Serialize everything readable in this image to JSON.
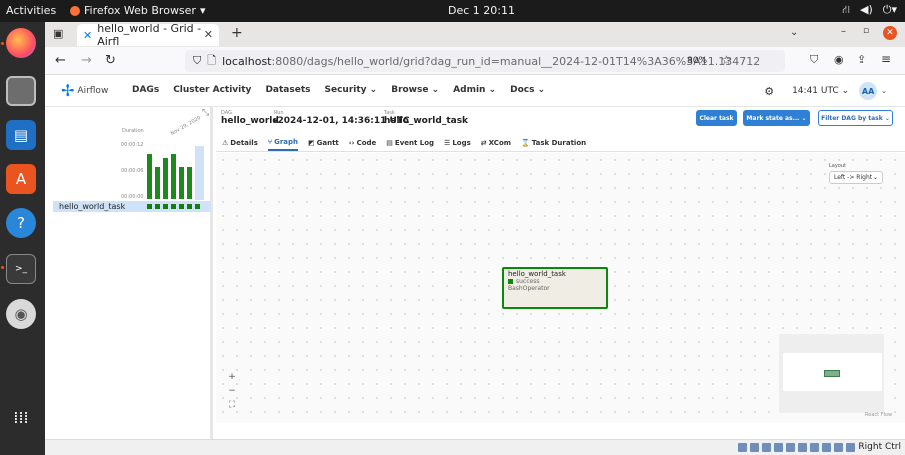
{
  "topbar": {
    "activities": "Activities",
    "app_name": "Firefox Web Browser",
    "app_caret": "▾",
    "clock": "Dec 1  20:11",
    "tray_icons": [
      "network-icon",
      "volume-icon",
      "power-icon"
    ]
  },
  "dock": {
    "items": [
      "firefox-icon",
      "files-icon",
      "writer-icon",
      "software-icon",
      "help-icon",
      "terminal-icon",
      "disc-icon",
      "apps-grid-icon"
    ]
  },
  "browser": {
    "tab_title": "hello_world - Grid - Airfl",
    "url_host": "localhost",
    "url_rest": ":8080/dags/hello_world/grid?dag_run_id=manual__2024-12-01T14%3A36%3A11.134712",
    "zoom": "80%"
  },
  "airflow": {
    "brand": "Airflow",
    "menu": [
      "DAGs",
      "Cluster Activity",
      "Datasets",
      "Security",
      "Browse",
      "Admin",
      "Docs"
    ],
    "time": "14:41 UTC",
    "avatar": "AA"
  },
  "grid": {
    "duration_label": "Duration",
    "tick_top": "00:00:12",
    "tick_mid": "00:00:06",
    "tick_bottom": "00:00:00",
    "date_label": "Nov 29, 2020",
    "task_name": "hello_world_task",
    "run_durations": [
      10,
      7,
      9,
      10,
      7,
      7,
      8
    ],
    "task_status_color": "#107e10"
  },
  "header": {
    "dag_label": "DAG",
    "dag_value": "hello_world",
    "run_label": "Run",
    "run_value": "2024-12-01, 14:36:11 UTC",
    "task_label": "Task",
    "task_value": "hello_world_task",
    "clear_task": "Clear task",
    "mark_state": "Mark state as...",
    "filter_dag": "Filter DAG by task"
  },
  "tabs": [
    "Details",
    "Graph",
    "Gantt",
    "Code",
    "Event Log",
    "Logs",
    "XCom",
    "Task Duration"
  ],
  "graph": {
    "node_title": "hello_world_task",
    "node_status": "success",
    "node_operator": "BashOperator",
    "layout_label": "Layout",
    "layout_value": "Left -> Right",
    "reactflow_label": "React Flow",
    "success_color": "#0a8a0a"
  },
  "statusbar": {
    "right_ctrl": "Right Ctrl"
  }
}
